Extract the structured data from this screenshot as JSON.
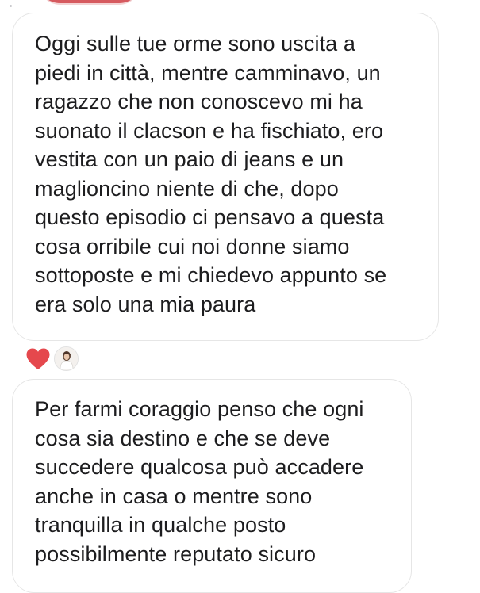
{
  "colors": {
    "bubble_border": "#e6e6e6",
    "text": "#1d1d1f",
    "heart": "#e5484d"
  },
  "messages": [
    {
      "lines": [
        "Oggi sulle tue orme sono uscita a",
        "piedi in città, mentre camminavo, un",
        "ragazzo che non conoscevo mi ha",
        "suonato il clacson e ha fischiato, ero",
        "vestita con un paio di jeans e un",
        "maglioncino niente di che, dopo",
        "questo episodio ci pensavo a questa",
        "cosa orribile cui noi donne siamo",
        "sottoposte e mi chiedevo appunto se",
        "era solo una mia paura"
      ]
    },
    {
      "lines": [
        "Per farmi coraggio penso che ogni",
        "cosa sia destino e che se deve",
        "succedere qualcosa può accadere",
        "anche in casa o mentre sono",
        "tranquilla in qualche posto",
        "possibilmente reputato sicuro"
      ]
    }
  ],
  "reactions": {
    "icon": "heart-icon",
    "reactor": "user-avatar"
  }
}
